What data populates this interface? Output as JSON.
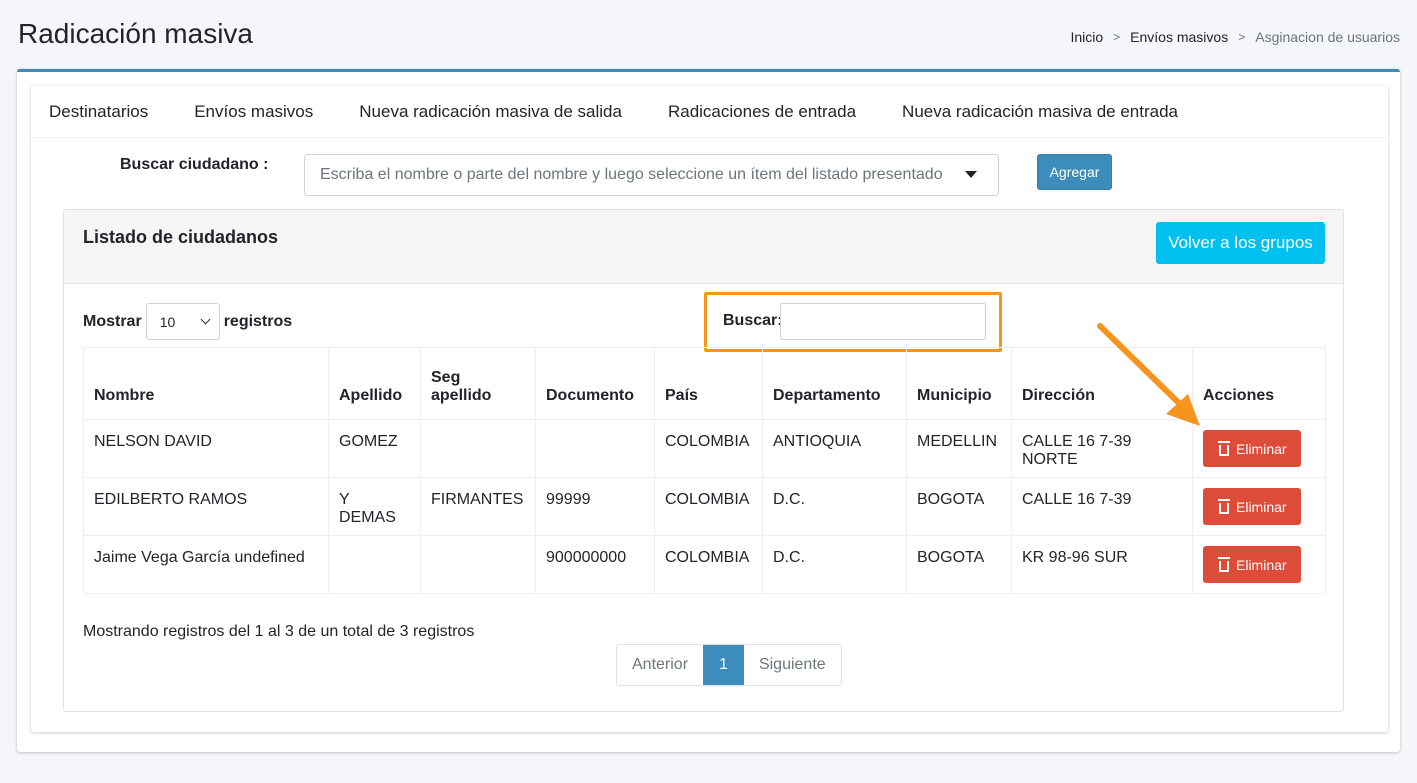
{
  "page": {
    "title": "Radicación masiva"
  },
  "breadcrumb": {
    "items": [
      "Inicio",
      "Envíos masivos",
      "Asginacion de usuarios"
    ],
    "separator": ">"
  },
  "tabs": [
    "Destinatarios",
    "Envíos masivos",
    "Nueva radicación masiva de salida",
    "Radicaciones de entrada",
    "Nueva radicación masiva de entrada"
  ],
  "citizen_search": {
    "label": "Buscar ciudadano :",
    "placeholder": "Escriba el nombre o parte del nombre y luego seleccione un ítem del listado presentado",
    "add_label": "Agregar"
  },
  "list": {
    "title": "Listado de ciudadanos",
    "back_label": "Volver a los grupos",
    "show_prefix": "Mostrar",
    "page_length": "10",
    "show_suffix": "registros",
    "search_label": "Buscar:",
    "search_value": "",
    "columns": [
      "Nombre",
      "Apellido",
      "Seg apellido",
      "Documento",
      "País",
      "Departamento",
      "Municipio",
      "Dirección",
      "Acciones"
    ],
    "rows": [
      [
        "NELSON DAVID",
        "GOMEZ",
        "",
        "",
        "COLOMBIA",
        "ANTIOQUIA",
        "MEDELLIN",
        "CALLE 16 7-39 NORTE"
      ],
      [
        "EDILBERTO RAMOS",
        "Y DEMAS",
        "FIRMANTES",
        "99999",
        "COLOMBIA",
        "D.C.",
        "BOGOTA",
        "CALLE 16 7-39"
      ],
      [
        "Jaime Vega García undefined",
        "",
        "",
        "900000000",
        "COLOMBIA",
        "D.C.",
        "BOGOTA",
        "KR 98-96 SUR"
      ]
    ],
    "delete_label": "Eliminar",
    "info": "Mostrando registros del 1 al 3 de un total de 3 registros",
    "pager": {
      "prev": "Anterior",
      "current": "1",
      "next": "Siguiente"
    }
  },
  "colors": {
    "primary": "#3c8dbc",
    "info": "#00c0ef",
    "danger": "#dd4b39",
    "highlight": "#f7941d"
  }
}
